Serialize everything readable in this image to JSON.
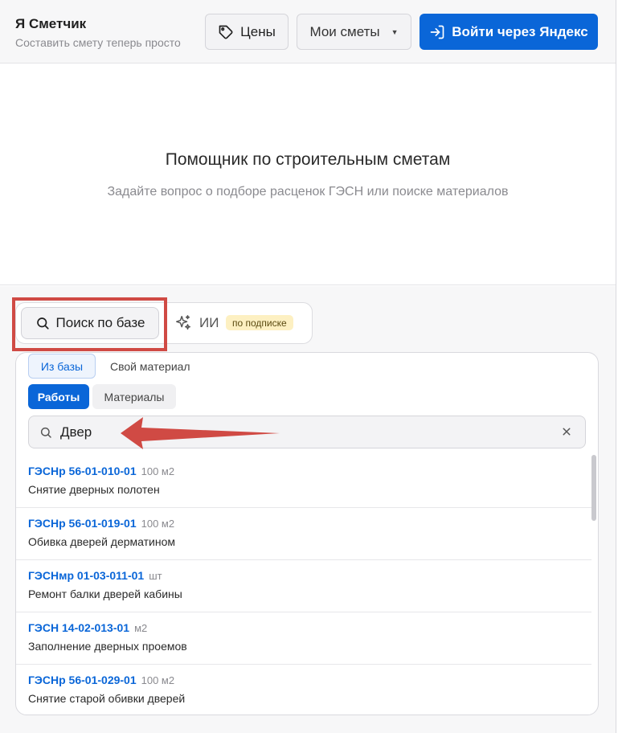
{
  "header": {
    "brand_title": "Я Сметчик",
    "brand_subtitle": "Составить смету теперь просто",
    "prices_label": "Цены",
    "estimates_label": "Мои сметы",
    "login_label": "Войти через Яндекс"
  },
  "assistant": {
    "title": "Помощник по строительным сметам",
    "subtitle": "Задайте вопрос о подборе расценок ГЭСН или поиске материалов"
  },
  "modes": {
    "search_label": "Поиск по базе",
    "ai_label": "ИИ",
    "ai_badge": "по подписке"
  },
  "panel": {
    "source_tabs": [
      "Из базы",
      "Свой материал"
    ],
    "kind_tabs": [
      "Работы",
      "Материалы"
    ],
    "search_value": "Двер",
    "results": [
      {
        "code": "ГЭСНр 56-01-010-01",
        "unit": "100 м2",
        "name": "Снятие дверных полотен"
      },
      {
        "code": "ГЭСНр 56-01-019-01",
        "unit": "100 м2",
        "name": "Обивка дверей дерматином"
      },
      {
        "code": "ГЭСНмр 01-03-011-01",
        "unit": "шт",
        "name": "Ремонт балки дверей кабины"
      },
      {
        "code": "ГЭСН 14-02-013-01",
        "unit": "м2",
        "name": "Заполнение дверных проемов"
      },
      {
        "code": "ГЭСНр 56-01-029-01",
        "unit": "100 м2",
        "name": "Снятие старой обивки дверей"
      }
    ]
  },
  "colors": {
    "accent": "#0a66d8",
    "highlight": "#d04a44",
    "badge_bg": "#fdf0c2"
  },
  "icons": {
    "prices": "tag-icon",
    "estimates": "caret-down-icon",
    "login": "login-icon",
    "search": "search-icon",
    "ai": "sparkles-icon",
    "clear": "close-icon"
  }
}
